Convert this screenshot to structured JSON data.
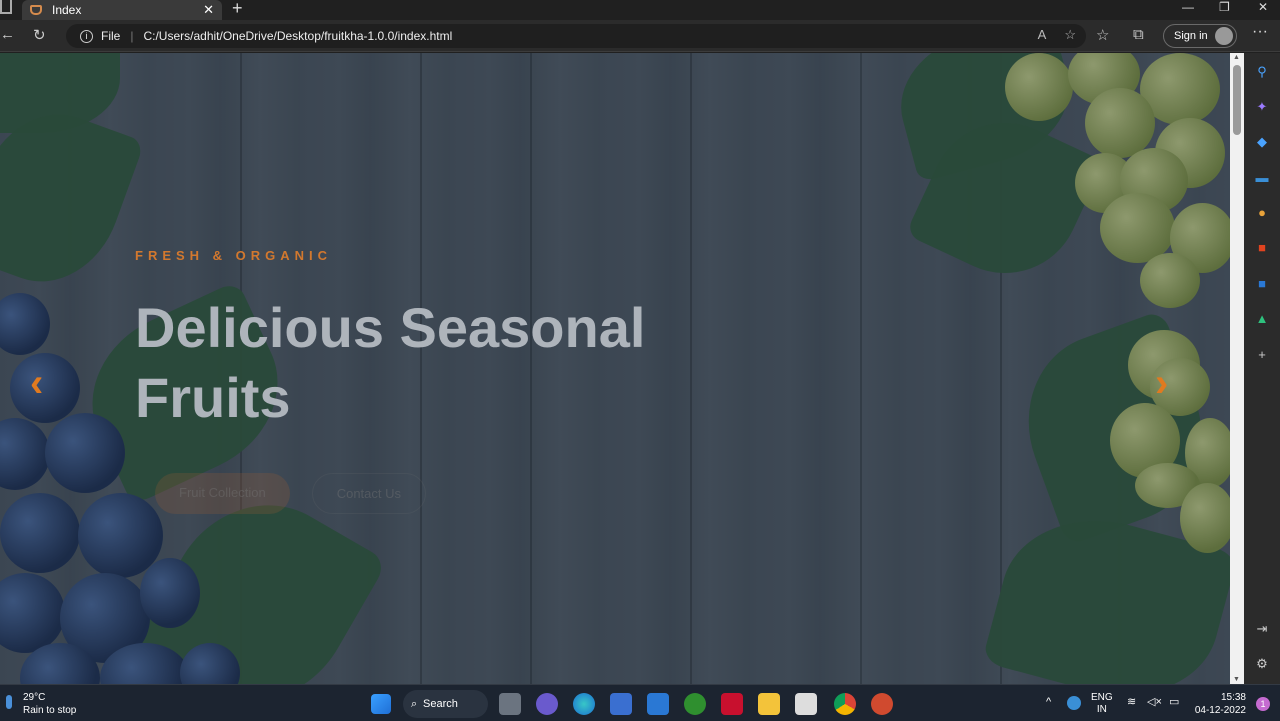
{
  "browser": {
    "tab_title": "Index",
    "tab_close": "✕",
    "new_tab": "+",
    "window_controls": {
      "minimize": "—",
      "maximize": "❐",
      "close": "✕"
    },
    "address_label": "File",
    "address_url": "C:/Users/adhit/OneDrive/Desktop/fruitkha-1.0.0/index.html",
    "signin_label": "Sign in",
    "read_aloud": "A",
    "favorite_add": "☆",
    "favorites": "☆",
    "collections": "⧉",
    "more": "···",
    "back": "←",
    "refresh": "↻"
  },
  "hero": {
    "subtitle": "FRESH & ORGANIC",
    "headline": "Delicious Seasonal Fruits",
    "primary_button": "Fruit Collection",
    "secondary_button": "Contact Us",
    "prev_arrow": "‹",
    "next_arrow": "›"
  },
  "sidebar": {
    "search": "⚲",
    "add": "+",
    "settings": "⚙"
  },
  "taskbar": {
    "temperature": "29°C",
    "weather_text": "Rain to stop",
    "search_label": "Search",
    "language": "ENG",
    "region": "IN",
    "time": "15:38",
    "date": "04-12-2022",
    "notification_count": "1",
    "chevron": "^"
  },
  "colors": {
    "accent": "#d2782e",
    "headline": "#aeb4bb",
    "taskbar": "#1c2430"
  }
}
